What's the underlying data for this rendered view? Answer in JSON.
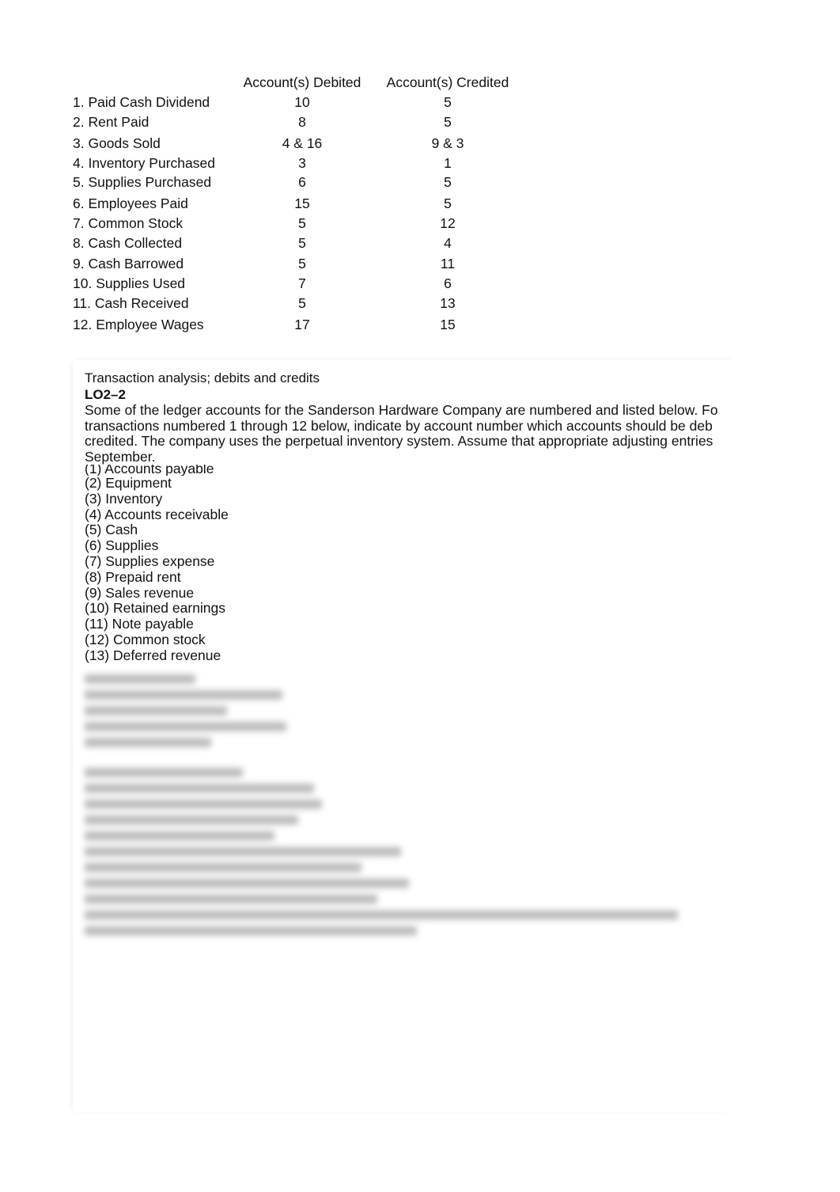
{
  "answer_table": {
    "headers": {
      "transaction": "",
      "debited": "Account(s) Debited",
      "credited": "Account(s) Credited"
    },
    "rows": [
      {
        "label": "1. Paid Cash Dividend",
        "debited": "10",
        "credited": "5"
      },
      {
        "label": "2. Rent Paid",
        "debited": "8",
        "credited": "5"
      },
      {
        "label": "3. Goods Sold",
        "debited": "4 & 16",
        "credited": "9 & 3"
      },
      {
        "label": "4. Inventory Purchased",
        "debited": "3",
        "credited": "1"
      },
      {
        "label": "5. Supplies Purchased",
        "debited": "6",
        "credited": "5"
      },
      {
        "label": "6. Employees Paid",
        "debited": "15",
        "credited": "5"
      },
      {
        "label": "7. Common Stock",
        "debited": "5",
        "credited": "12"
      },
      {
        "label": "8. Cash Collected",
        "debited": "5",
        "credited": "4"
      },
      {
        "label": "9. Cash Barrowed",
        "debited": "5",
        "credited": "11"
      },
      {
        "label": "10. Supplies Used",
        "debited": "7",
        "credited": "6"
      },
      {
        "label": "11. Cash Received",
        "debited": "5",
        "credited": "13"
      },
      {
        "label": "12. Employee Wages",
        "debited": "17",
        "credited": "15"
      }
    ]
  },
  "problem": {
    "title": "Transaction analysis; debits and credits",
    "objective": "LO2–2",
    "body_lines": [
      "Some of the ledger accounts for the Sanderson Hardware Company are numbered and listed below. Fo",
      "transactions numbered 1 through 12 below, indicate by account number which accounts should be deb",
      "credited. The company uses the perpetual inventory system. Assume that appropriate adjusting entries",
      "September."
    ],
    "accounts": [
      "(1) Accounts payable",
      "(2) Equipment",
      "(3) Inventory",
      "(4) Accounts receivable",
      "(5) Cash",
      "(6) Supplies",
      "(7) Supplies expense",
      "(8) Prepaid rent",
      "(9) Sales revenue",
      "(10) Retained earnings",
      "(11) Note payable",
      "(12) Common stock",
      "(13) Deferred revenue"
    ],
    "blurred_note": "Remaining content is blurred (preview locked)"
  }
}
